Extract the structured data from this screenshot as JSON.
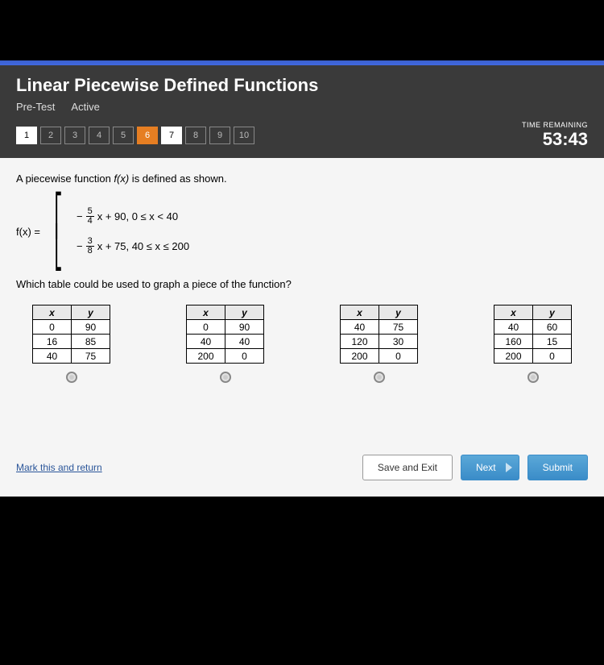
{
  "header": {
    "title": "Linear Piecewise Defined Functions",
    "status1": "Pre-Test",
    "status2": "Active",
    "timer_label": "TIME REMAINING",
    "timer_value": "53:43"
  },
  "nav": {
    "items": [
      "1",
      "2",
      "3",
      "4",
      "5",
      "6",
      "7",
      "8",
      "9",
      "10"
    ],
    "current": 6,
    "white": [
      1,
      7
    ]
  },
  "question": {
    "intro_a": "A piecewise function ",
    "intro_fx": "f(x)",
    "intro_b": " is defined as shown.",
    "fx_label": "f(x) =",
    "piece1": {
      "neg": "−",
      "num": "5",
      "den": "4",
      "rest": "x + 90,   0 ≤ x < 40"
    },
    "piece2": {
      "neg": "−",
      "num": "3",
      "den": "8",
      "rest": "x + 75,   40 ≤ x ≤ 200"
    },
    "prompt": "Which table could be used to graph a piece of the function?"
  },
  "tables": [
    {
      "headers": [
        "x",
        "y"
      ],
      "rows": [
        [
          "0",
          "90"
        ],
        [
          "16",
          "85"
        ],
        [
          "40",
          "75"
        ]
      ]
    },
    {
      "headers": [
        "x",
        "y"
      ],
      "rows": [
        [
          "0",
          "90"
        ],
        [
          "40",
          "40"
        ],
        [
          "200",
          "0"
        ]
      ]
    },
    {
      "headers": [
        "x",
        "y"
      ],
      "rows": [
        [
          "40",
          "75"
        ],
        [
          "120",
          "30"
        ],
        [
          "200",
          "0"
        ]
      ]
    },
    {
      "headers": [
        "x",
        "y"
      ],
      "rows": [
        [
          "40",
          "60"
        ],
        [
          "160",
          "15"
        ],
        [
          "200",
          "0"
        ]
      ]
    }
  ],
  "footer": {
    "mark": "Mark this and return",
    "save": "Save and Exit",
    "next": "Next",
    "submit": "Submit"
  }
}
